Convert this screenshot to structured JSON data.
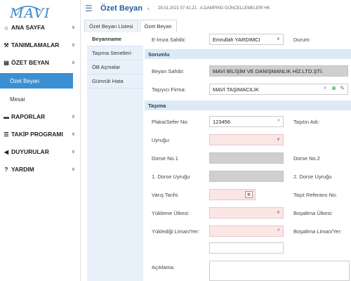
{
  "brand": {
    "logo_text": "MAVI"
  },
  "sidebar": {
    "items": [
      {
        "icon": "home-icon",
        "icon_glyph": "⌂",
        "label": "ANA SAYFA"
      },
      {
        "icon": "wrench-icon",
        "icon_glyph": "⚒",
        "label": "TANIMLAMALAR"
      },
      {
        "icon": "document-icon",
        "icon_glyph": "▤",
        "label": "ÖZET BEYAN"
      },
      {
        "icon": "folder-icon",
        "icon_glyph": "▬",
        "label": "RAPORLAR"
      },
      {
        "icon": "list-icon",
        "icon_glyph": "☰",
        "label": "TAKİP PROGRAMI"
      },
      {
        "icon": "megaphone-icon",
        "icon_glyph": "◀",
        "label": "DUYURULAR"
      },
      {
        "icon": "help-icon",
        "icon_glyph": "?",
        "label": "YARDIM"
      }
    ],
    "sub_items": [
      {
        "label": "Özet Beyan"
      },
      {
        "label": "Mesai"
      }
    ]
  },
  "header": {
    "page_title": "Özet Beyan",
    "marquee": "28.01.2021 07:41:21 : A.DAMPING GÜNCELLEMELERİ HK"
  },
  "tabs": [
    {
      "label": "Özet Beyan Listesi"
    },
    {
      "label": "Özet Beyan"
    }
  ],
  "subnav": [
    {
      "label": "Beyanname"
    },
    {
      "label": "Taşıma Senetleri"
    },
    {
      "label": "ÖB Açmalar"
    },
    {
      "label": "Gümrük Hata"
    }
  ],
  "form": {
    "eimza_label": "E-İmza Sahibi:",
    "eimza_value": "Emrullah YARDIMCI",
    "durum_label": "Durum:",
    "section_sorumlu": "Sorumlu",
    "beyan_sahibi_label": "Beyan Sahibi:",
    "beyan_sahibi_value": "MAVİ BİLİŞİM VE DANIŞMANLIK HİZ.LTD.ŞTİ.",
    "tasiyici_label": "Taşıyıcı Firma:",
    "tasiyici_value": "MAVİ TAŞIMACILIK",
    "section_tasima": "Taşıma",
    "plaka_label": "Plaka/Sefer No:",
    "plaka_value": "123456",
    "tasit_adi_label": "Taşıtın Adı:",
    "uyrugu_label": "Uyruğu:",
    "dorse1_label": "Dorse No.1",
    "dorse2_label": "Dorse No.2",
    "dorse1_uyrugu_label": "1. Dorse Uyruğu",
    "dorse2_uyrugu_label": "2. Dorse Uyruğu",
    "varis_label": "Varış Tarihi:",
    "tasit_ref_label": "Taşıt Referans No:",
    "yukleme_ulkesi_label": "Yükleme Ülkesi:",
    "bosaltma_ulkesi_label": "Boşaltma Ülkesi:",
    "yukledigi_liman_label": "Yüklediği Liman/Yer:",
    "bosaltma_liman_label": "Boşaltma Liman/Yer:",
    "aciklama_label": "Açıklama:"
  }
}
